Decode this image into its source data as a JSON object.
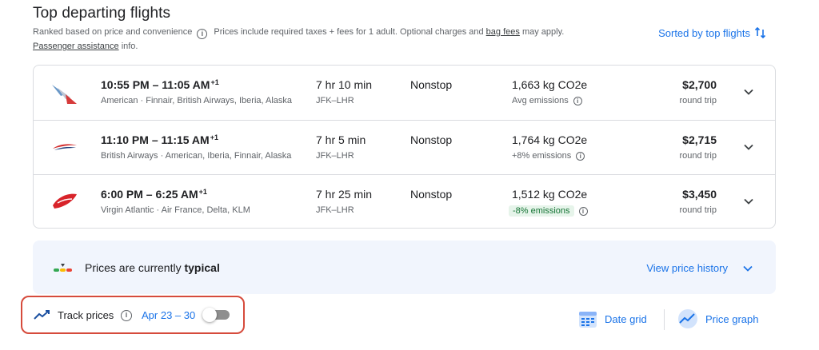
{
  "header": {
    "title": "Top departing flights",
    "ranked_text": "Ranked based on price and convenience",
    "info_glyph": "i",
    "price_note_prefix": "Prices include required taxes + fees for 1 adult. Optional charges and",
    "bag_fees_link": "bag fees",
    "price_note_suffix": "may apply.",
    "assistance_link": "Passenger assistance",
    "assistance_suffix": "info.",
    "sorted_label": "Sorted by top flights"
  },
  "flights": [
    {
      "airline_logo": "american-airlines-logo",
      "depart": "10:55 PM",
      "arrive": "11:05 AM",
      "day_offset": "+1",
      "airlines": "American · Finnair, British Airways, Iberia, Alaska",
      "duration": "7 hr 10 min",
      "route": "JFK–LHR",
      "stops": "Nonstop",
      "co2": "1,663 kg CO2e",
      "emissions": "Avg emissions",
      "price": "$2,700",
      "trip_type": "round trip"
    },
    {
      "airline_logo": "british-airways-logo",
      "depart": "11:10 PM",
      "arrive": "11:15 AM",
      "day_offset": "+1",
      "airlines": "British Airways · American, Iberia, Finnair, Alaska",
      "duration": "7 hr 5 min",
      "route": "JFK–LHR",
      "stops": "Nonstop",
      "co2": "1,764 kg CO2e",
      "emissions": "+8% emissions",
      "price": "$2,715",
      "trip_type": "round trip"
    },
    {
      "airline_logo": "virgin-atlantic-logo",
      "depart": "6:00 PM",
      "arrive": "6:25 AM",
      "day_offset": "+1",
      "airlines": "Virgin Atlantic · Air France, Delta, KLM",
      "duration": "7 hr 25 min",
      "route": "JFK–LHR",
      "stops": "Nonstop",
      "co2": "1,512 kg CO2e",
      "emissions": "-8% emissions",
      "price": "$3,450",
      "trip_type": "round trip"
    }
  ],
  "insight": {
    "prefix": "Prices are currently",
    "level": "typical",
    "link": "View price history"
  },
  "track": {
    "label": "Track prices",
    "dates": "Apr 23 – 30",
    "enabled": false
  },
  "tools": {
    "date_grid": "Date grid",
    "price_graph": "Price graph"
  },
  "colors": {
    "accent": "#1a73e8",
    "highlight_border": "#d64b3c",
    "green_badge_bg": "#e6f4ea",
    "green_badge_text": "#137333"
  }
}
